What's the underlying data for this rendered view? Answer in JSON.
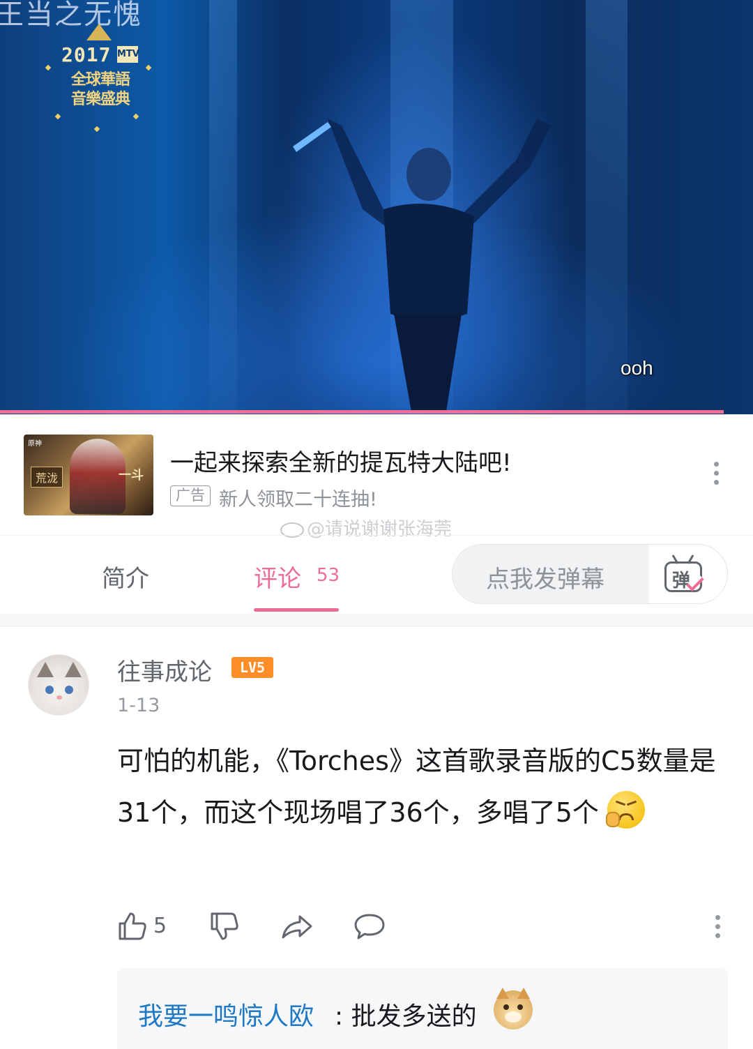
{
  "video": {
    "top_watermark": "王当之无愧",
    "logo": {
      "year": "2017",
      "brand": "MTV",
      "line1": "全球華語",
      "line2": "音樂盛典"
    },
    "subtitle": "ooh",
    "progress_fraction": 0.961,
    "progress_color": "#f16e97"
  },
  "ad": {
    "title": "一起来探索全新的提瓦特大陆吧!",
    "badge": "广告",
    "subtitle": "新人领取二十连抽!",
    "thumbnail": {
      "brand": "原神",
      "left_tag": "荒泷",
      "right_text": "一斗"
    },
    "overlay_watermark": "@请说谢谢张海莞"
  },
  "tabs": {
    "intro_label": "简介",
    "comments_label": "评论",
    "comments_count": "53",
    "active_color": "#ee6d95",
    "danmaku_placeholder": "点我发弹幕",
    "danmaku_toggle_char": "弹"
  },
  "comment": {
    "username": "往事成论",
    "level": "LV5",
    "date": "1-13",
    "text": "可怕的机能，《Torches》这首歌录音版的C5数量是31个，而这个现场唱了36个，多唱了5个",
    "emoji": "angry-face-emoji",
    "likes": "5",
    "reply": {
      "username": "我要一鸣惊人欧",
      "text": ": 批发多送的",
      "emoji": "doge-emoji"
    }
  }
}
